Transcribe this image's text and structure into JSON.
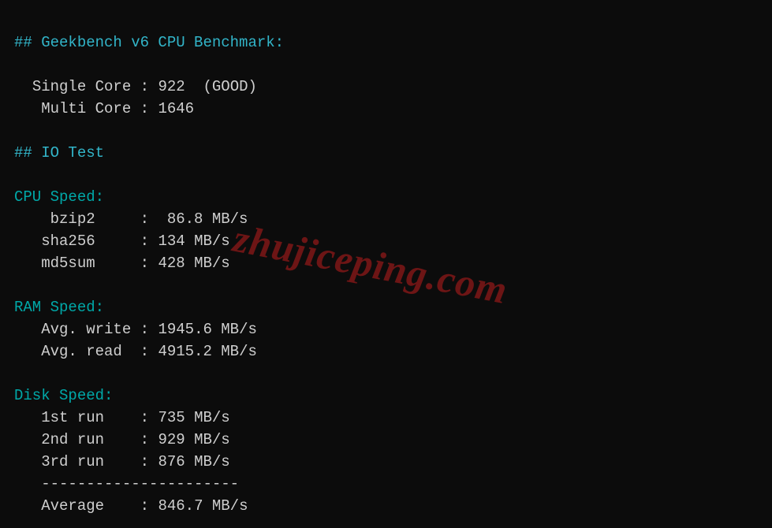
{
  "sections": {
    "geekbench": {
      "header": "## Geekbench v6 CPU Benchmark:",
      "single_label": "Single Core",
      "single_value": "922",
      "single_note": "(GOOD)",
      "multi_label": "Multi Core",
      "multi_value": "1646"
    },
    "io": {
      "header": "## IO Test"
    },
    "cpu": {
      "header": "CPU Speed:",
      "rows": [
        {
          "label": "bzip2",
          "value": "86.8 MB/s"
        },
        {
          "label": "sha256",
          "value": "134 MB/s"
        },
        {
          "label": "md5sum",
          "value": "428 MB/s"
        }
      ]
    },
    "ram": {
      "header": "RAM Speed:",
      "rows": [
        {
          "label": "Avg. write",
          "value": "1945.6 MB/s"
        },
        {
          "label": "Avg. read",
          "value": "4915.2 MB/s"
        }
      ]
    },
    "disk": {
      "header": "Disk Speed:",
      "rows": [
        {
          "label": "1st run",
          "value": "735 MB/s"
        },
        {
          "label": "2nd run",
          "value": "929 MB/s"
        },
        {
          "label": "3rd run",
          "value": "876 MB/s"
        }
      ],
      "divider": "----------------------",
      "avg_label": "Average",
      "avg_value": "846.7 MB/s"
    }
  },
  "watermark": "zhujiceping.com"
}
